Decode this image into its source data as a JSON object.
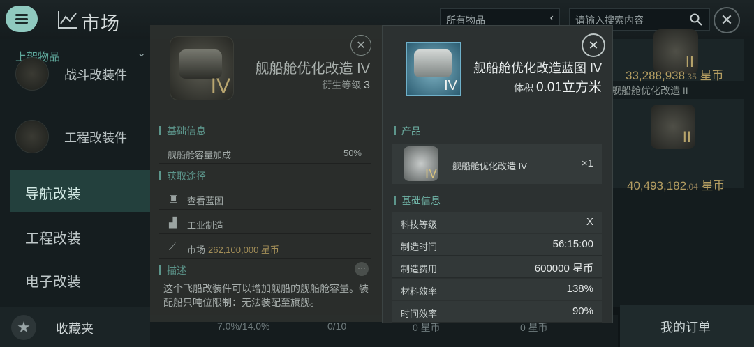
{
  "header": {
    "title": "市场",
    "filter_value": "所有物品",
    "search_placeholder": "请输入搜索内容"
  },
  "sidebar": {
    "section_label": "上架物品",
    "modules": [
      {
        "label": "战斗改装件"
      },
      {
        "label": "工程改装件"
      }
    ],
    "nav": [
      {
        "label": "导航改装"
      },
      {
        "label": "工程改装"
      },
      {
        "label": "电子改装"
      }
    ],
    "favorites_label": "收藏夹"
  },
  "background_list": {
    "price_1_main": "33,288,938",
    "price_1_dec": ".35",
    "price_unit": "星币",
    "item_2_name": "舰船舱优化改造 II",
    "price_2_main": "40,493,182",
    "price_2_dec": ".04",
    "tier_badge": "II"
  },
  "bottom_bar": {
    "stat_1": "7.0%/14.0%",
    "stat_2": "0/10",
    "stat_3": "0 星币",
    "stat_4": "0 星币",
    "orders_label": "我的订单"
  },
  "item_panel": {
    "name": "舰船舱优化改造 IV",
    "tier_badge": "IV",
    "meta_level_label": "衍生等级",
    "meta_level": "3",
    "basic_info_header": "基础信息",
    "attr_label": "舰船舱容量加成",
    "attr_value": "50%",
    "sources_header": "获取途径",
    "source_blueprint": "查看蓝图",
    "source_industry": "工业制造",
    "source_market_label": "市场",
    "source_market_price": "262,100,000 星币",
    "desc_header": "描述",
    "description": "这个飞船改装件可以增加舰船的舰船舱容量。装配船只吨位限制：无法装配至旗舰。"
  },
  "blueprint_panel": {
    "name": "舰船舱优化改造蓝图 IV",
    "tier_badge": "IV",
    "volume_label": "体积",
    "volume_value": "0.01立方米",
    "product_header": "产品",
    "product_name": "舰船舱优化改造 IV",
    "product_qty": "×1",
    "basic_info_header": "基础信息",
    "rows": [
      {
        "label": "科技等级",
        "value": "X"
      },
      {
        "label": "制造时间",
        "value": "56:15:00"
      },
      {
        "label": "制造费用",
        "value": "600000 星币"
      },
      {
        "label": "材料效率",
        "value": "138%"
      },
      {
        "label": "时间效率",
        "value": "90%"
      }
    ]
  },
  "colors": {
    "accent": "#8fc9bf",
    "active_nav": "#23403d",
    "price_gold": "#b59e62",
    "blueprint_frame": "#6fb0c9"
  },
  "icons": [
    "menu-icon",
    "market-chart-icon",
    "chevron-left-icon",
    "search-icon",
    "close-icon",
    "star-icon",
    "blueprint-icon",
    "factory-icon",
    "more-icon"
  ]
}
